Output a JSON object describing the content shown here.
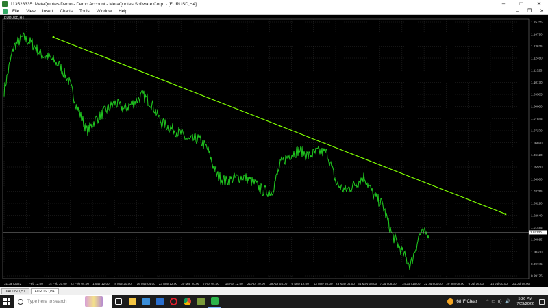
{
  "window": {
    "title": "113528335: MetaQuotes-Demo - Demo Account - MetaQuotes Software Corp. - [EURUSD,H4]",
    "controls": [
      "–",
      "□",
      "✕"
    ]
  },
  "menu": {
    "items": [
      "File",
      "View",
      "Insert",
      "Charts",
      "Tools",
      "Window",
      "Help"
    ],
    "mdi_controls": [
      "–",
      "❐",
      "✕"
    ]
  },
  "chart": {
    "symbol_label": "EURUSD,H4",
    "line_color": "#1fc21f",
    "trendline_color": "#7fff00",
    "grid_color": "#3a3a3a",
    "current_price": "1.02130"
  },
  "chart_data": {
    "type": "line",
    "title": "",
    "xlabel": "",
    "ylabel": "",
    "ylim": [
      0.99175,
      1.15755
    ],
    "y_ticks": [
      "1.15755",
      "1.14790",
      "1.13635",
      "1.12460",
      "1.11325",
      "1.10170",
      "1.09585",
      "1.09000",
      "1.07845",
      "1.07270",
      "1.06690",
      "1.06120",
      "1.05550",
      "1.04960",
      "1.03795",
      "1.03220",
      "1.02640",
      "1.01485",
      "1.00915",
      "1.00330",
      "0.99745",
      "0.99175"
    ],
    "x_ticks": [
      "31 Jan 2022",
      "7 Feb 12:00",
      "14 Feb 20:00",
      "22 Feb 04:00",
      "1 Mar 12:00",
      "8 Mar 20:00",
      "16 Mar 04:00",
      "23 Mar 12:00",
      "30 Mar 20:00",
      "7 Apr 04:00",
      "14 Apr 12:00",
      "21 Apr 20:00",
      "29 Apr 04:00",
      "6 May 12:00",
      "13 May 20:00",
      "23 May 04:00",
      "31 May 08:00",
      "7 Jun 08:00",
      "14 Jun 16:00",
      "22 Jun 00:00",
      "29 Jun 08:00",
      "6 Jul 16:00",
      "14 Jul 00:00",
      "21 Jul 08:00"
    ],
    "series": [
      {
        "x": [
          "31 Jan 2022",
          "3 Feb",
          "7 Feb",
          "10 Feb",
          "14 Feb",
          "17 Feb",
          "22 Feb",
          "25 Feb",
          "1 Mar",
          "4 Mar",
          "8 Mar",
          "11 Mar",
          "16 Mar",
          "19 Mar",
          "23 Mar",
          "27 Mar",
          "30 Mar",
          "3 Apr",
          "7 Apr",
          "10 Apr",
          "14 Apr",
          "17 Apr",
          "21 Apr",
          "25 Apr",
          "29 Apr",
          "3 May",
          "6 May",
          "10 May",
          "13 May",
          "17 May",
          "23 May",
          "27 May",
          "31 May",
          "3 Jun",
          "7 Jun",
          "10 Jun",
          "14 Jun",
          "18 Jun",
          "22 Jun",
          "25 Jun",
          "29 Jun",
          "2 Jul",
          "6 Jul",
          "9 Jul",
          "14 Jul",
          "17 Jul",
          "21 Jul"
        ],
        "values": [
          1.112,
          1.1395,
          1.146,
          1.142,
          1.135,
          1.1325,
          1.128,
          1.118,
          1.1,
          1.086,
          1.094,
          1.099,
          1.104,
          1.1,
          1.104,
          1.109,
          1.1035,
          1.092,
          1.088,
          1.085,
          1.08,
          1.081,
          1.075,
          1.058,
          1.054,
          1.056,
          1.057,
          1.053,
          1.048,
          1.047,
          1.066,
          1.071,
          1.074,
          1.07,
          1.073,
          1.072,
          1.052,
          1.048,
          1.052,
          1.057,
          1.045,
          1.039,
          1.02,
          1.01,
          1.0,
          1.02,
          1.021
        ]
      }
    ],
    "trendline": {
      "from": [
        "14 Feb 20:00",
        1.146
      ],
      "to": [
        "21 Jul 08:00",
        1.033
      ]
    },
    "grid": true
  },
  "tabs": [
    "XAUUSD,H1",
    "EURUSD,H4"
  ],
  "taskbar": {
    "search_placeholder": "Type here to search",
    "weather": "68°F  Clear",
    "time": "5:26 PM",
    "date": "7/23/2022",
    "tray_icons": [
      "^",
      "▭",
      "((·",
      "🔊"
    ]
  }
}
